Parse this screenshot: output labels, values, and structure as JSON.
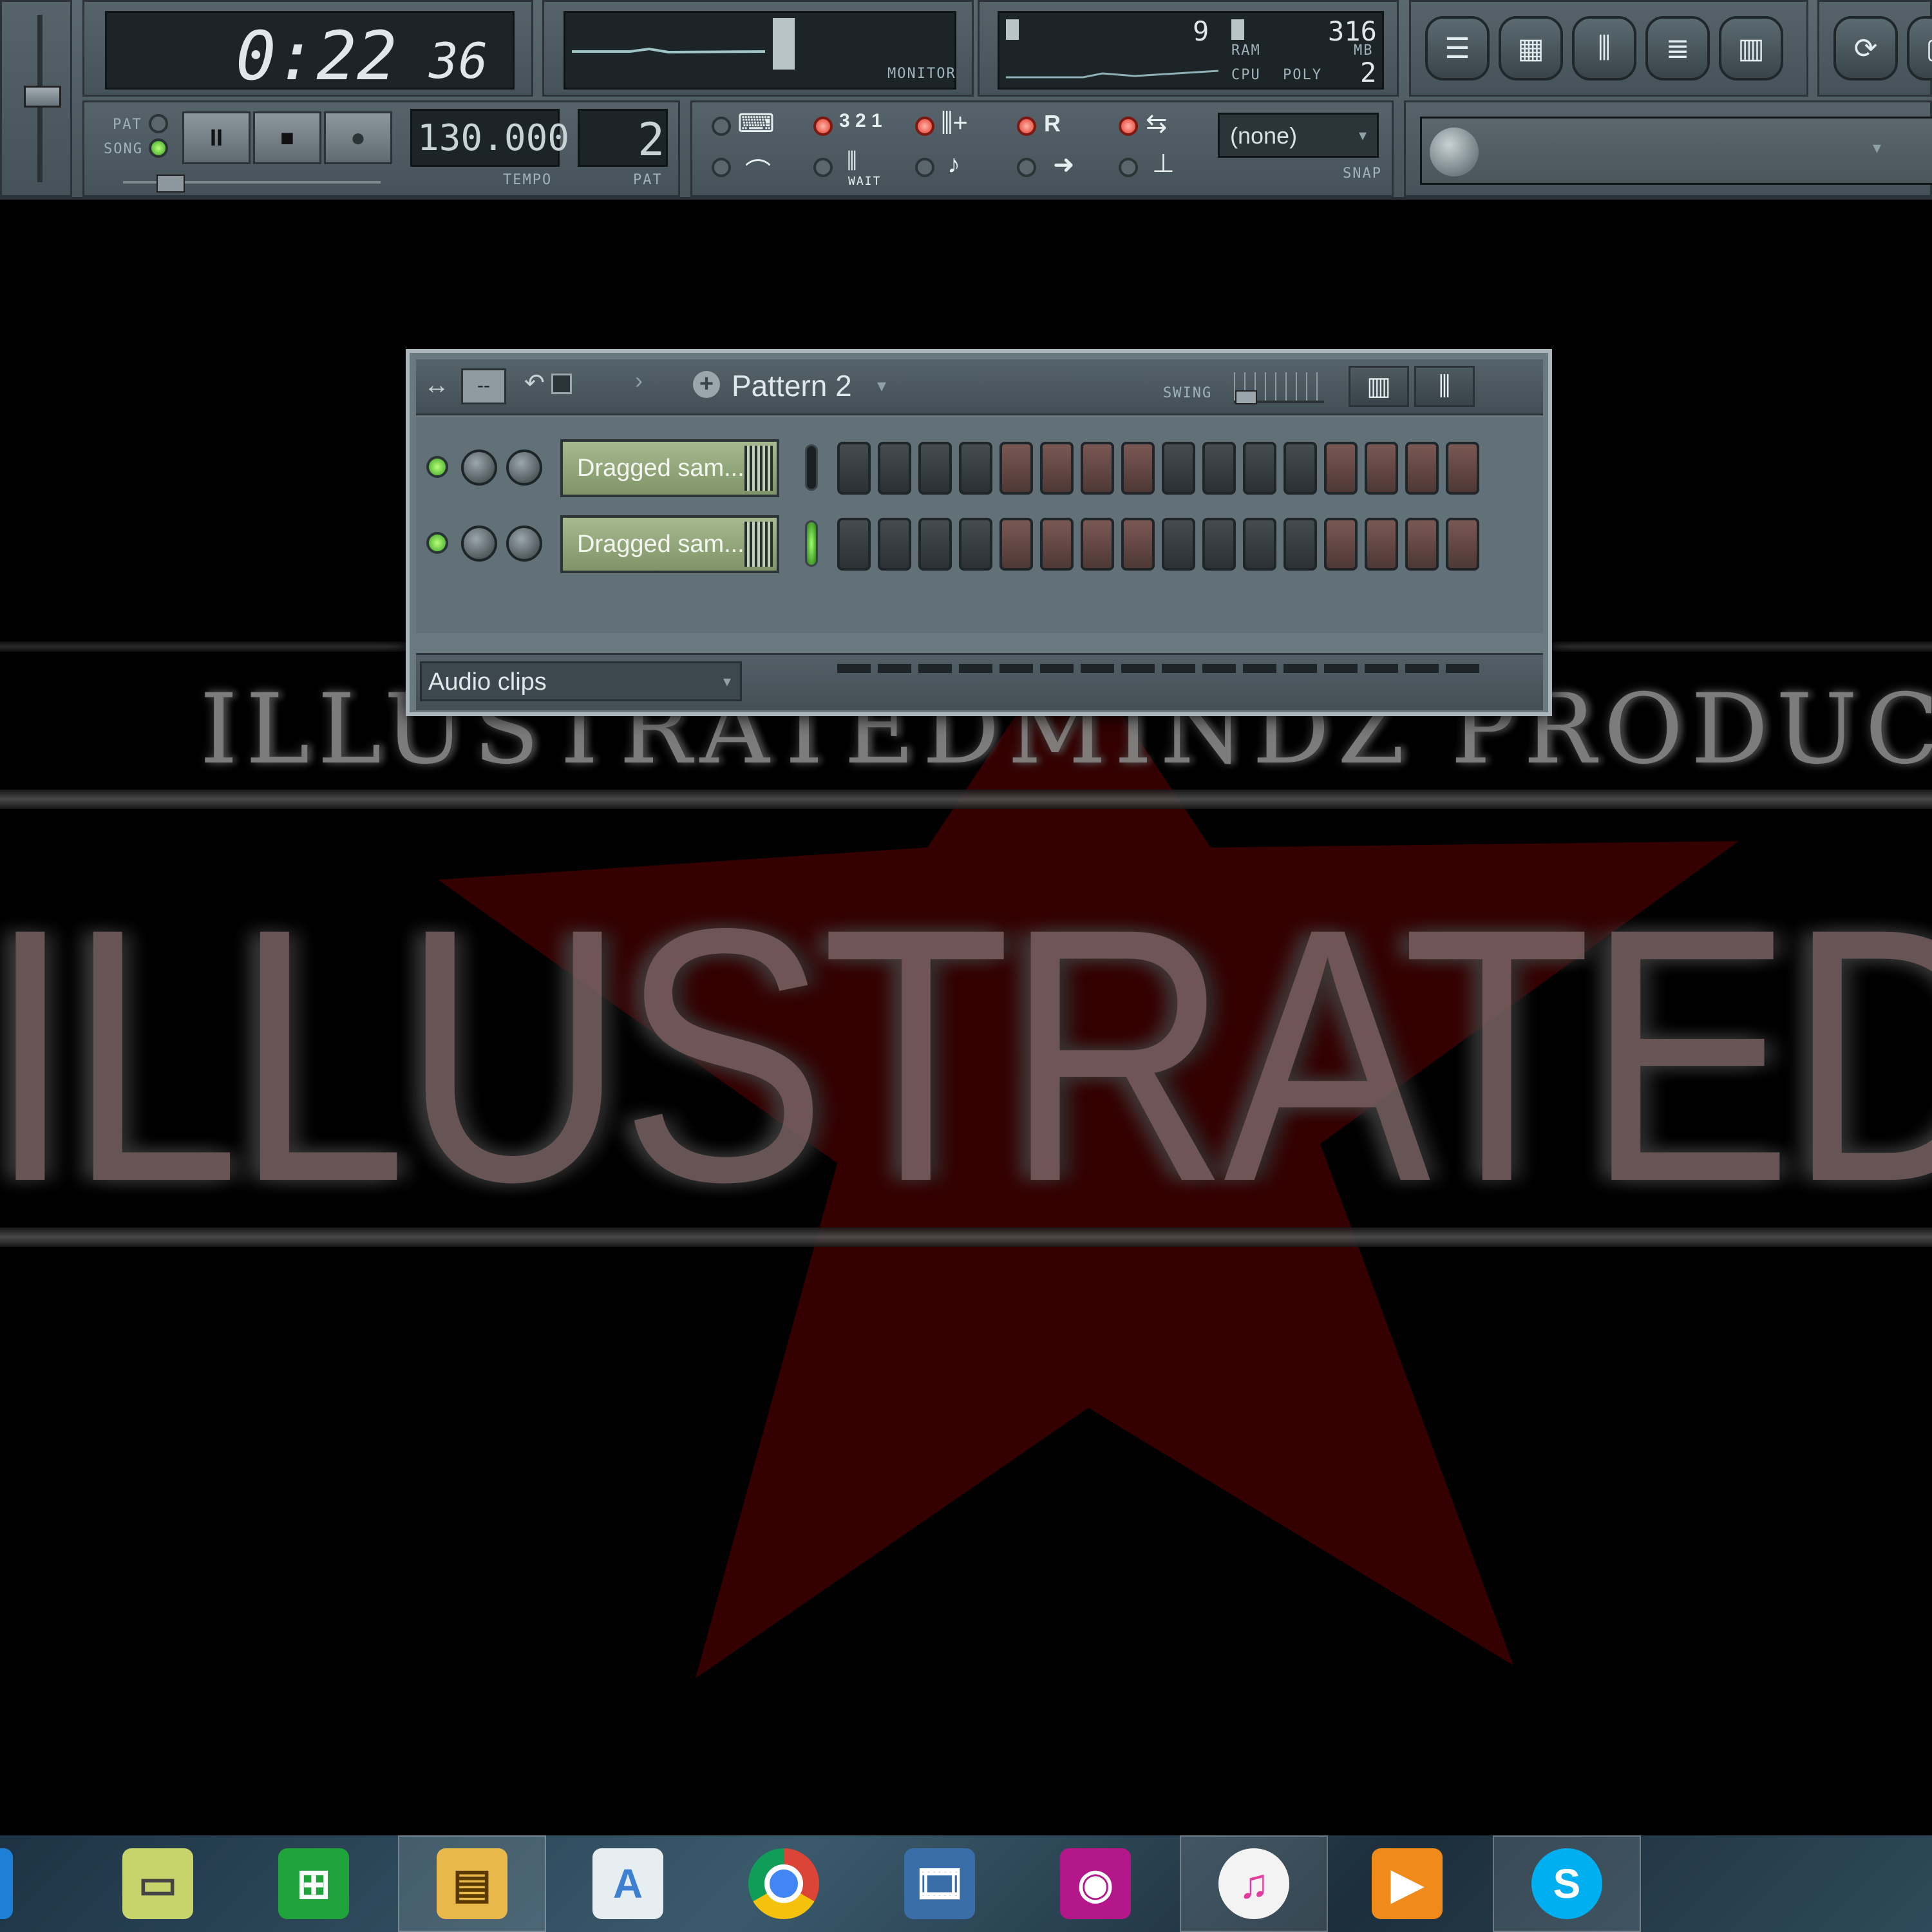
{
  "toolbar": {
    "time": {
      "minutes_seconds": "0:22",
      "ticks": "36"
    },
    "pat_label": "PAT",
    "song_label": "SONG",
    "transport": {
      "pause": "II",
      "stop": "■",
      "record": "●"
    },
    "tempo": {
      "value": "130.000",
      "label": "TEMPO"
    },
    "pattern": {
      "value": "2",
      "label": "PAT"
    },
    "monitor_label": "MONITOR",
    "meters": {
      "cpu_value": "9",
      "ram_value": "316",
      "ram_label": "RAM",
      "mb_label": "MB",
      "cpu_label": "CPU",
      "poly_label": "POLY",
      "poly_value": "2"
    },
    "snap": {
      "value": "(none)",
      "label": "SNAP"
    },
    "wait_label": "WAIT",
    "countdown_label": "3 2 1",
    "rec_label": "R"
  },
  "sequencer": {
    "pattern_title": "Pattern 2",
    "swing_label": "SWING",
    "channels": [
      {
        "name": "Dragged sam..."
      },
      {
        "name": "Dragged sam..."
      }
    ],
    "footer_filter": "Audio clips"
  },
  "art": {
    "subtitle": "ILLUSTRATEDMINDZ PRODUCTIONS",
    "title": "ILLUSTRATEDMADE",
    "colors": {
      "star": "#3a0000",
      "title": "#7a6464"
    }
  },
  "taskbar": {
    "items": [
      {
        "icon": "mail-icon",
        "color": "#1e7fd6"
      },
      {
        "icon": "sticky-notes-icon",
        "color": "#c7d36b"
      },
      {
        "icon": "store-icon",
        "color": "#1fa33a"
      },
      {
        "icon": "file-explorer-icon",
        "color": "#e8b84a"
      },
      {
        "icon": "wordpad-icon",
        "color": "#3d7fd0"
      },
      {
        "icon": "chrome-icon",
        "color": "#db4437"
      },
      {
        "icon": "movie-maker-icon",
        "color": "#3a6ea8"
      },
      {
        "icon": "camera-icon",
        "color": "#b3178a"
      },
      {
        "icon": "itunes-icon",
        "color": "#e43b9c"
      },
      {
        "icon": "media-player-icon",
        "color": "#f08a1b"
      },
      {
        "icon": "skype-icon",
        "color": "#00aff0"
      }
    ]
  }
}
